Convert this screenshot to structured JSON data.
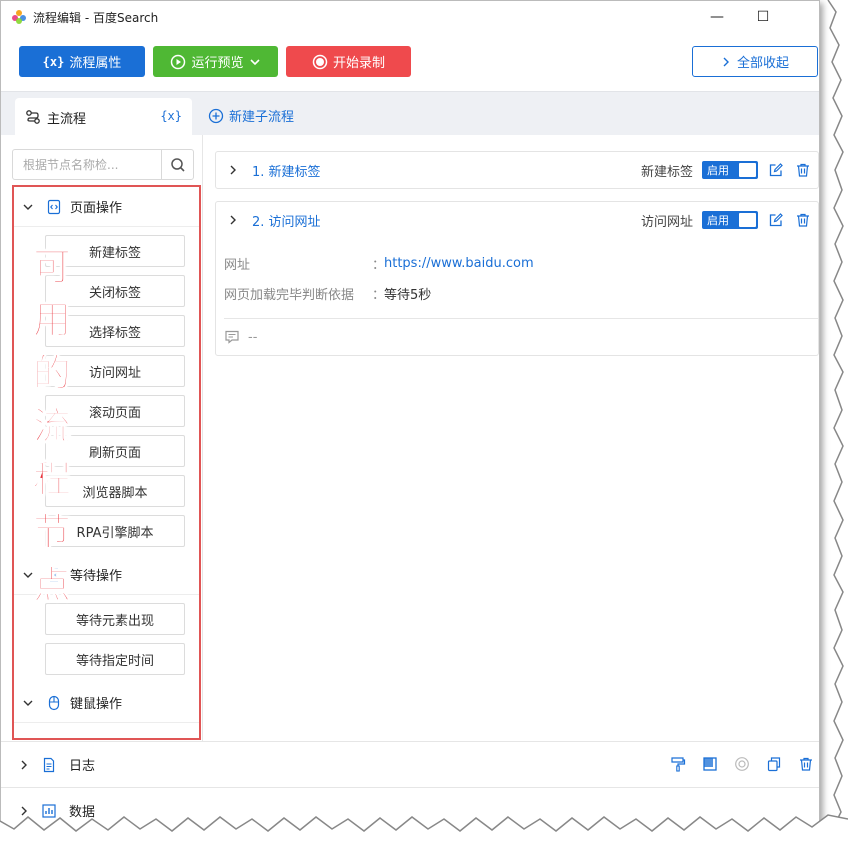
{
  "window": {
    "title": "流程编辑 - 百度Search",
    "minimize_glyph": "—",
    "maximize_glyph": "☐"
  },
  "toolbar": {
    "props_label": "流程属性",
    "props_icon_text": "{x}",
    "run_label": "运行预览",
    "record_label": "开始录制",
    "collapse_label": "全部收起"
  },
  "tabs": {
    "main_label": "主流程",
    "var_label": "{x}",
    "new_subflow_label": "新建子流程"
  },
  "sidebar": {
    "search_placeholder": "根据节点名称检...",
    "groups": [
      {
        "label": "页面操作",
        "icon": "code-page-icon",
        "items": [
          "新建标签",
          "关闭标签",
          "选择标签",
          "访问网址",
          "滚动页面",
          "刷新页面",
          "浏览器脚本",
          "RPA引擎脚本"
        ]
      },
      {
        "label": "等待操作",
        "icon": "hourglass-icon",
        "items": [
          "等待元素出现",
          "等待指定时间"
        ]
      },
      {
        "label": "键鼠操作",
        "icon": "mouse-icon",
        "items": []
      }
    ],
    "overlay_chars": [
      "可",
      "用",
      "的",
      "流",
      "程",
      "节",
      "点"
    ]
  },
  "steps": [
    {
      "title": "1. 新建标签",
      "right_label": "新建标签",
      "toggle_label": "启用",
      "expanded": false
    },
    {
      "title": "2. 访问网址",
      "right_label": "访问网址",
      "toggle_label": "启用",
      "expanded": true,
      "fields": [
        {
          "key": "网址",
          "sep": "：",
          "value": "https://www.baidu.com",
          "is_link": true
        },
        {
          "key": "网页加载完毕判断依据",
          "sep": "：",
          "value": "等待5秒",
          "is_link": false
        }
      ],
      "comment": "--"
    }
  ],
  "bottom": {
    "log_label": "日志",
    "data_label": "数据"
  },
  "colors": {
    "primary": "#1a6fd6",
    "run_green": "#4fb834",
    "record_red": "#ef4a4d",
    "highlight_red": "#e05555"
  }
}
